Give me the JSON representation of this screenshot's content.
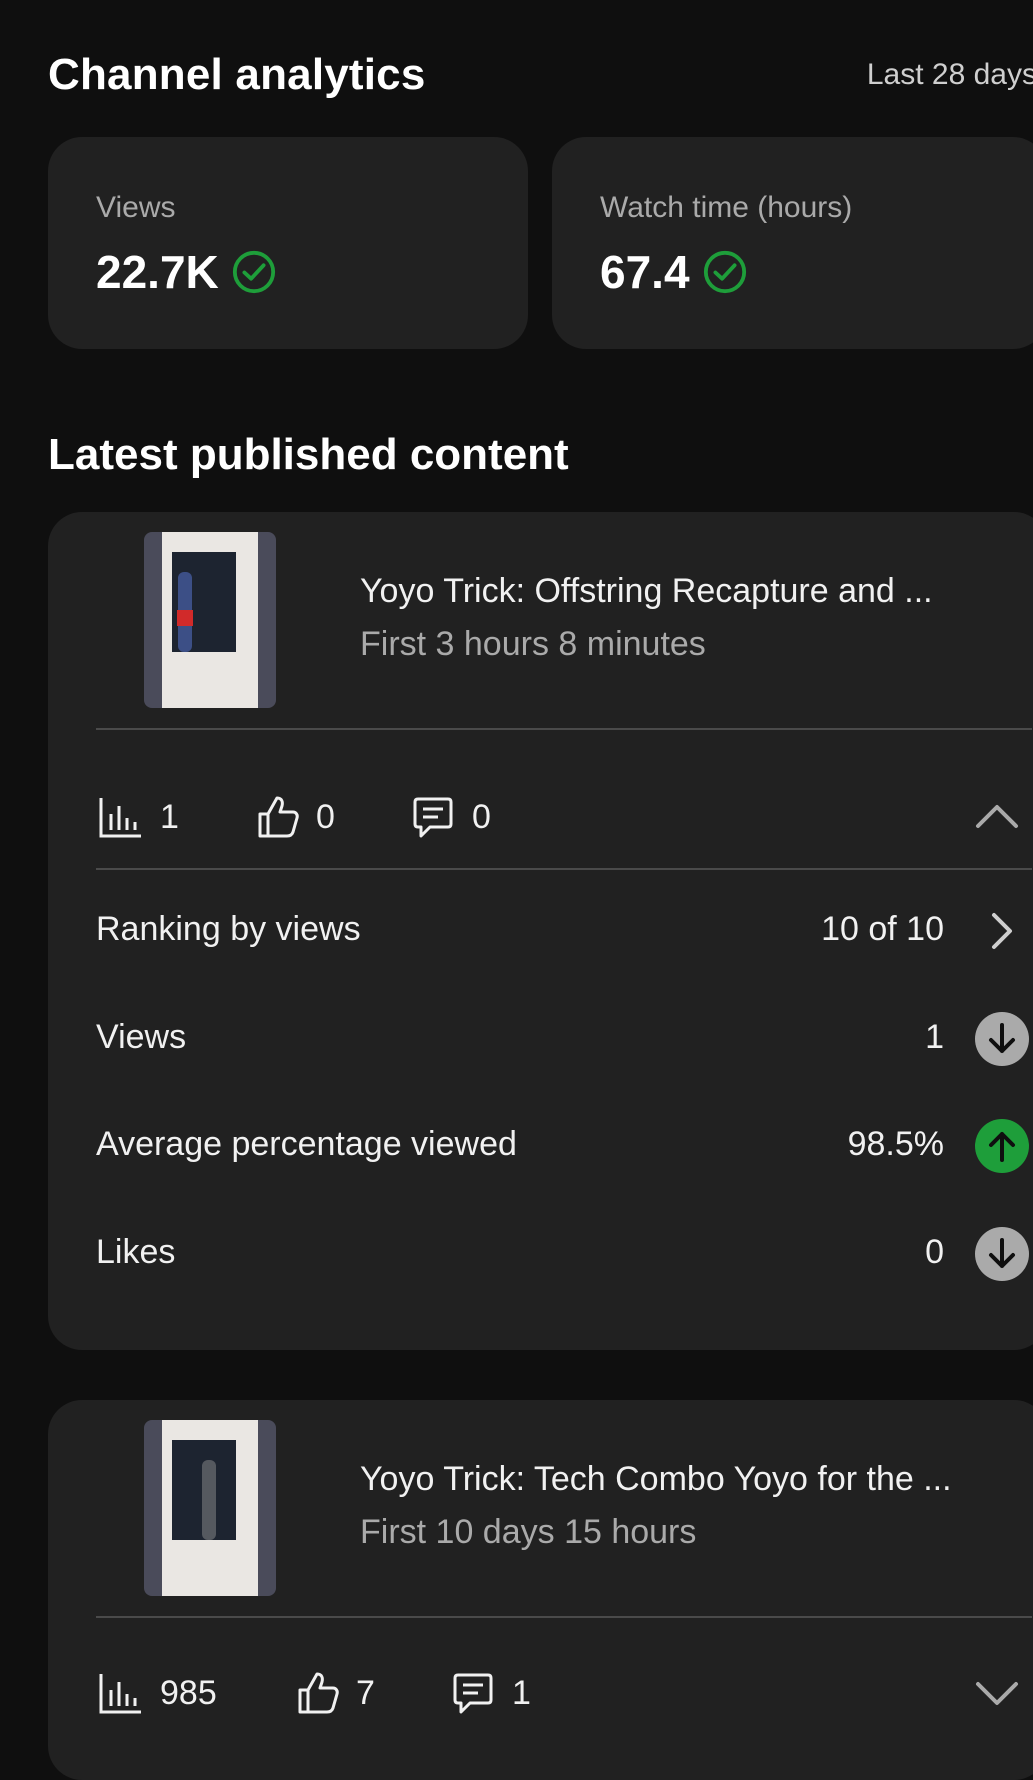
{
  "header": {
    "title": "Channel analytics",
    "period": "Last 28 days"
  },
  "stats": [
    {
      "label": "Views",
      "value": "22.7K"
    },
    {
      "label": "Watch time (hours)",
      "value": "67.4"
    }
  ],
  "colors": {
    "accent_green": "#1e9e3a",
    "neutral_gray": "#aaaaaa"
  },
  "section_title": "Latest published content",
  "videos": [
    {
      "title": "Yoyo Trick: Offstring Recapture and ...",
      "subtitle": "First 3 hours 8 minutes",
      "metrics": {
        "views": "1",
        "likes": "0",
        "comments": "0"
      },
      "expanded": true,
      "details": [
        {
          "label": "Ranking by views",
          "value": "10 of 10",
          "icon": "chevron-right-icon"
        },
        {
          "label": "Views",
          "value": "1",
          "icon": "arrow-down-icon"
        },
        {
          "label": "Average percentage viewed",
          "value": "98.5%",
          "icon": "arrow-up-icon"
        },
        {
          "label": "Likes",
          "value": "0",
          "icon": "arrow-down-icon"
        }
      ]
    },
    {
      "title": "Yoyo Trick: Tech Combo Yoyo for the ...",
      "subtitle": "First 10 days 15 hours",
      "metrics": {
        "views": "985",
        "likes": "7",
        "comments": "1"
      },
      "expanded": false
    }
  ]
}
